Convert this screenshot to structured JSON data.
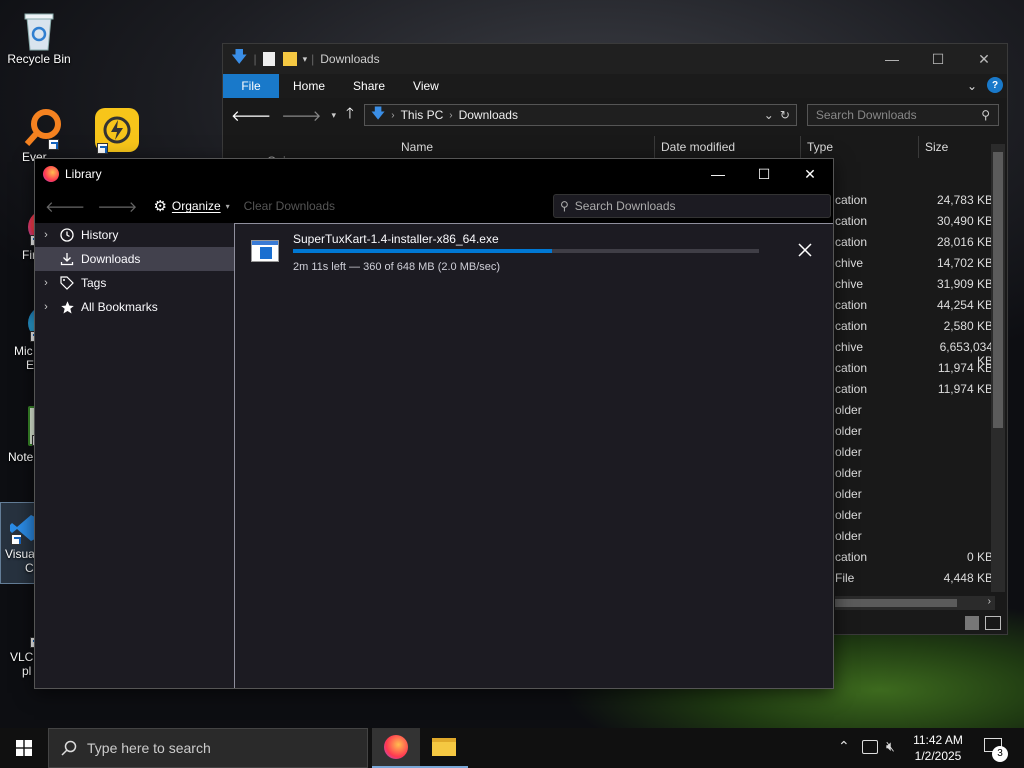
{
  "desktop": {
    "icons": [
      {
        "label": "Recycle Bin"
      },
      {
        "label": "Ever"
      },
      {
        "label": "Fir"
      },
      {
        "label": "Mic",
        "label2": "E"
      },
      {
        "label": "Note"
      },
      {
        "label": "Visua",
        "label2": "C"
      },
      {
        "label": "VLC",
        "label2": "pl"
      }
    ]
  },
  "explorer": {
    "title": "Downloads",
    "ribbon_tabs": [
      "File",
      "Home",
      "Share",
      "View"
    ],
    "breadcrumb": [
      "This PC",
      "Downloads"
    ],
    "search_placeholder": "Search Downloads",
    "columns": [
      "Name",
      "Date modified",
      "Type",
      "Size"
    ],
    "partial_item": "Quic",
    "rows": [
      {
        "type": "cation",
        "size": "24,783 KB"
      },
      {
        "type": "cation",
        "size": "30,490 KB"
      },
      {
        "type": "cation",
        "size": "28,016 KB"
      },
      {
        "type": "chive",
        "size": "14,702 KB"
      },
      {
        "type": "chive",
        "size": "31,909 KB"
      },
      {
        "type": "cation",
        "size": "44,254 KB"
      },
      {
        "type": "cation",
        "size": "2,580 KB"
      },
      {
        "type": "chive",
        "size": "6,653,034 KB"
      },
      {
        "type": "cation",
        "size": "11,974 KB"
      },
      {
        "type": "cation",
        "size": "11,974 KB"
      },
      {
        "type": "older",
        "size": ""
      },
      {
        "type": "older",
        "size": ""
      },
      {
        "type": "older",
        "size": ""
      },
      {
        "type": "older",
        "size": ""
      },
      {
        "type": "older",
        "size": ""
      },
      {
        "type": "older",
        "size": ""
      },
      {
        "type": "older",
        "size": ""
      },
      {
        "type": "cation",
        "size": "0 KB"
      },
      {
        "type": "File",
        "size": "4,448 KB"
      }
    ]
  },
  "library": {
    "title": "Library",
    "toolbar": {
      "organize_label": "Organize",
      "clear_label": "Clear Downloads",
      "search_placeholder": "Search Downloads"
    },
    "sidebar": [
      {
        "label": "History",
        "icon": "clock-icon",
        "expandable": true
      },
      {
        "label": "Downloads",
        "icon": "download-icon",
        "expandable": false,
        "selected": true
      },
      {
        "label": "Tags",
        "icon": "tag-icon",
        "expandable": true
      },
      {
        "label": "All Bookmarks",
        "icon": "star-icon",
        "expandable": true
      }
    ],
    "download": {
      "filename": "SuperTuxKart-1.4-installer-x86_64.exe",
      "status": "2m 11s left — 360 of 648 MB (2.0 MB/sec)",
      "progress": 0.556
    }
  },
  "taskbar": {
    "search_placeholder": "Type here to search",
    "time": "11:42 AM",
    "date": "1/2/2025",
    "notification_count": "3"
  },
  "colors": {
    "accent": "#1979ca",
    "progress_fill": "#0078d4",
    "library_bg": "#1c1b22"
  }
}
